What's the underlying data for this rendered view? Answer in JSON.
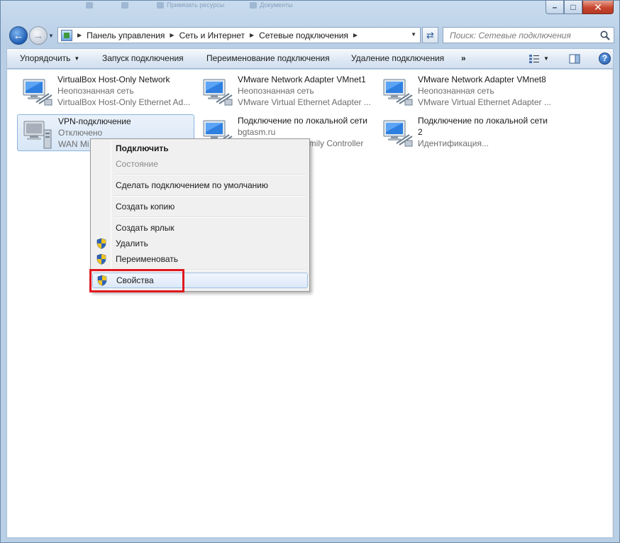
{
  "window": {
    "buttons": {
      "minimize": "–",
      "maximize": "□",
      "close": "✕"
    },
    "ghost_tabs": [
      "",
      "",
      "Привязать ресурсы",
      "Документы"
    ]
  },
  "nav": {
    "breadcrumbs": [
      "Панель управления",
      "Сеть и Интернет",
      "Сетевые подключения"
    ],
    "search_placeholder": "Поиск: Сетевые подключения"
  },
  "toolbar": {
    "organize": "Упорядочить",
    "start": "Запуск подключения",
    "rename": "Переименование подключения",
    "delete": "Удаление подключения",
    "more": "»",
    "help": "?"
  },
  "items": [
    {
      "name": "VirtualBox Host-Only Network",
      "status": "Неопознанная сеть",
      "device": "VirtualBox Host-Only Ethernet Ad..."
    },
    {
      "name": "VMware Network Adapter VMnet1",
      "status": "Неопознанная сеть",
      "device": "VMware Virtual Ethernet Adapter ..."
    },
    {
      "name": "VMware Network Adapter VMnet8",
      "status": "Неопознанная сеть",
      "device": "VMware Virtual Ethernet Adapter ..."
    },
    {
      "name": "VPN-подключение",
      "status": "Отключено",
      "device": "WAN Mi"
    },
    {
      "name": "Подключение по локальной сети",
      "status": "bgtasm.ru",
      "device": "amily Controller"
    },
    {
      "name": "Подключение по локальной сети",
      "name2": "2",
      "status": "Идентификация..."
    }
  ],
  "context_menu": {
    "connect": "Подключить",
    "status": "Состояние",
    "set_default": "Сделать подключением по умолчанию",
    "copy": "Создать копию",
    "shortcut": "Создать ярлык",
    "delete": "Удалить",
    "rename": "Переименовать",
    "properties": "Свойства"
  },
  "colors": {
    "highlight": "#e0181f",
    "selection": "#d8e6f6",
    "accent": "#1f5fb6"
  }
}
